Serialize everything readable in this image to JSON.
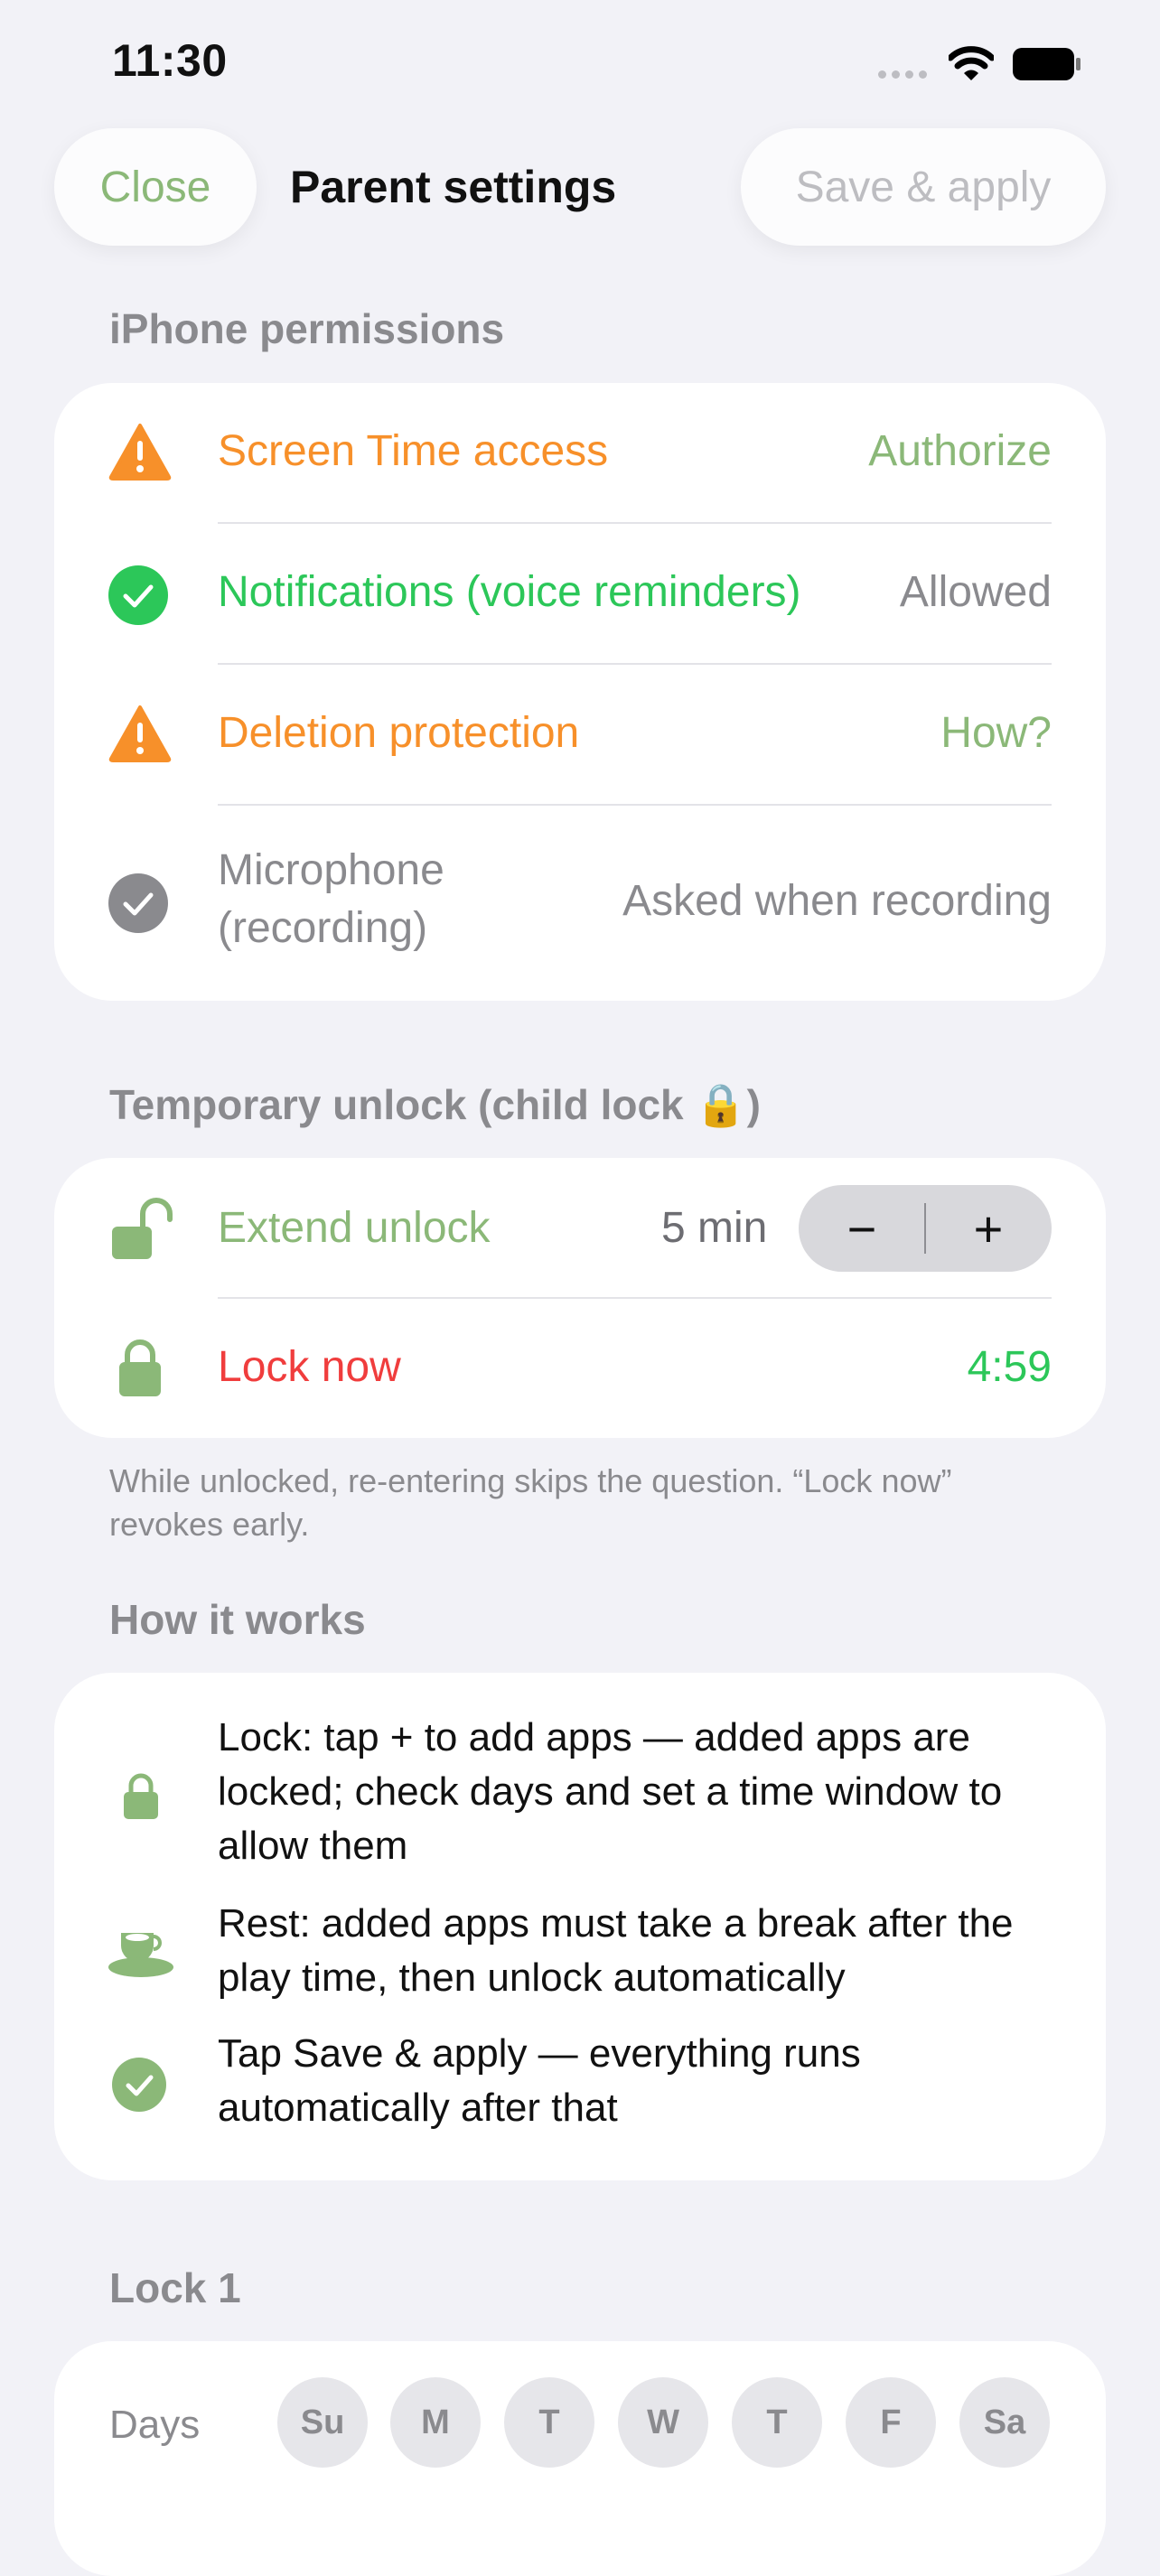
{
  "status_bar": {
    "time": "11:30"
  },
  "nav": {
    "close": "Close",
    "title": "Parent settings",
    "save": "Save & apply"
  },
  "permissions": {
    "section_title": "iPhone permissions",
    "rows": [
      {
        "label": "Screen Time access",
        "value": "Authorize",
        "icon": "warning-icon"
      },
      {
        "label": "Notifications (voice reminders)",
        "value": "Allowed",
        "icon": "check-circle-icon"
      },
      {
        "label": "Deletion protection",
        "value": "How?",
        "icon": "warning-icon"
      },
      {
        "label_line1": "Microphone",
        "label_line2": "(recording)",
        "value": "Asked when recording",
        "icon": "check-circle-icon"
      }
    ]
  },
  "unlock": {
    "section_title": "Temporary unlock (child lock 🔒)",
    "extend_label": "Extend unlock",
    "extend_value": "5 min",
    "minus": "−",
    "plus": "+",
    "lock_label": "Lock now",
    "lock_value": "4:59",
    "footnote": "While unlocked, re-entering skips the question. “Lock now” revokes early."
  },
  "how": {
    "section_title": "How it works",
    "items": [
      {
        "text": "Lock: tap + to add apps — added apps are locked; check days and set a time window to allow them",
        "icon": "lock-icon"
      },
      {
        "text": "Rest: added apps must take a break after the play time, then unlock automatically",
        "icon": "cup-icon"
      },
      {
        "text": "Tap Save & apply — everything runs automatically after that",
        "icon": "check-circle-icon"
      }
    ]
  },
  "lock1": {
    "section_title": "Lock 1",
    "days_label": "Days",
    "days": [
      "Su",
      "M",
      "T",
      "W",
      "T",
      "F",
      "Sa"
    ]
  },
  "colors": {
    "background": "#F2F2F7",
    "orange": "#F7902A",
    "green": "#2CC759",
    "sage": "#8BB878",
    "red": "#F03D3D",
    "gray": "#8A8A8E"
  }
}
